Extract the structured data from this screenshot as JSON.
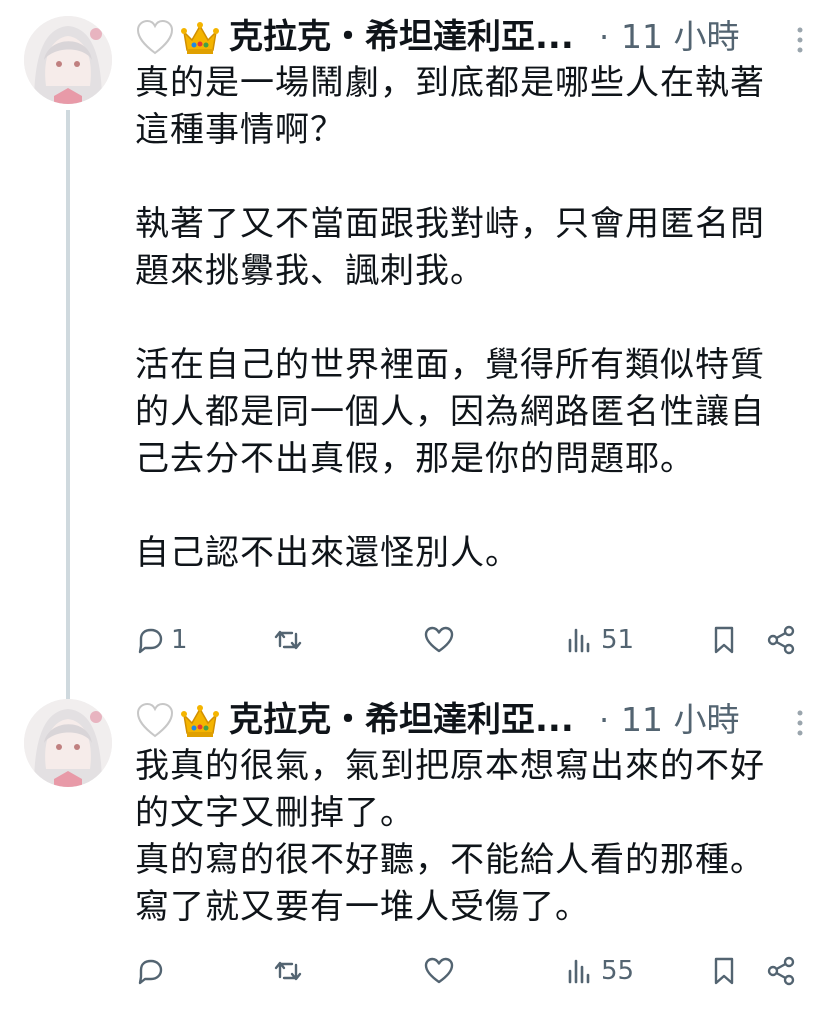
{
  "tweets": [
    {
      "display_name": "克拉克・希坦達利亞...",
      "separator": "·",
      "time": "11 小時",
      "text": "真的是一場鬧劇，到底都是哪些人在執著\n這種事情啊？\n\n執著了又不當面跟我對峙，只會用匿名問\n題來挑釁我、諷刺我。\n\n活在自己的世界裡面，覺得所有類似特質\n的人都是同一個人，因為網路匿名性讓自\n己去分不出真假，那是你的問題耶。\n\n自己認不出來還怪別人。",
      "reply_count": "1",
      "retweet_count": "",
      "like_count": "",
      "view_count": "51"
    },
    {
      "display_name": "克拉克・希坦達利亞...",
      "separator": "·",
      "time": "11 小時",
      "text": "我真的很氣，氣到把原本想寫出來的不好\n的文字又刪掉了。\n真的寫的很不好聽，不能給人看的那種。\n寫了就又要有一堆人受傷了。",
      "reply_count": "",
      "retweet_count": "",
      "like_count": "",
      "view_count": "55"
    }
  ],
  "icons": {
    "name_emojis": [
      "white-heart-icon",
      "crown-icon"
    ],
    "actions": [
      "reply-icon",
      "retweet-icon",
      "like-icon",
      "views-icon",
      "bookmark-icon",
      "share-icon"
    ],
    "more": "more-vertical-icon"
  },
  "colors": {
    "text": "#0f1419",
    "secondary": "#536471",
    "thread_line": "#cfd9de"
  }
}
